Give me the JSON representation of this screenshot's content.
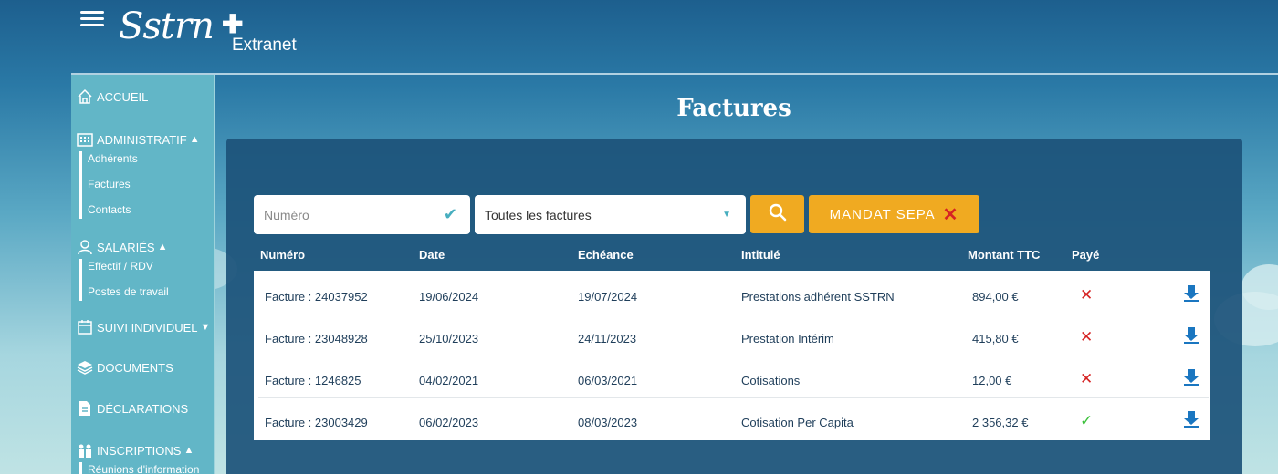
{
  "header": {
    "logo_script": "Sstrn",
    "logo_sub": "Extranet"
  },
  "sidebar": {
    "accueil": "ACCUEIL",
    "administratif": {
      "label": "ADMINISTRATIF",
      "items": [
        "Adhérents",
        "Factures",
        "Contacts"
      ]
    },
    "salaries": {
      "label": "SALARIÉS",
      "items": [
        "Effectif / RDV",
        "Postes de travail"
      ]
    },
    "suivi": "SUIVI INDIVIDUEL",
    "documents": "DOCUMENTS",
    "declarations": "DÉCLARATIONS",
    "inscriptions": {
      "label": "INSCRIPTIONS",
      "items": [
        "Réunions d'information"
      ]
    }
  },
  "main": {
    "title": "Factures",
    "search": {
      "numero_placeholder": "Numéro",
      "select_value": "Toutes les factures",
      "sepa_label": "MANDAT SEPA"
    },
    "columns": [
      "Numéro",
      "Date",
      "Echéance",
      "Intitulé",
      "Montant TTC",
      "Payé"
    ],
    "rows": [
      {
        "numero": "Facture : 24037952",
        "date": "19/06/2024",
        "echeance": "19/07/2024",
        "intitule": "Prestations adhérent SSTRN",
        "montant": "894,00 €",
        "paye": false
      },
      {
        "numero": "Facture : 23048928",
        "date": "25/10/2023",
        "echeance": "24/11/2023",
        "intitule": "Prestation Intérim",
        "montant": "415,80 €",
        "paye": false
      },
      {
        "numero": "Facture : 1246825",
        "date": "04/02/2021",
        "echeance": "06/03/2021",
        "intitule": "Cotisations",
        "montant": "12,00 €",
        "paye": false
      },
      {
        "numero": "Facture : 23003429",
        "date": "06/02/2023",
        "echeance": "08/03/2023",
        "intitule": "Cotisation Per Capita",
        "montant": "2 356,32 €",
        "paye": true
      }
    ]
  },
  "icons": {
    "paid": "check-icon",
    "unpaid": "cross-icon",
    "download": "download-icon"
  },
  "colors": {
    "accent": "#f0aa21",
    "unpaid": "#d62323",
    "paid": "#3cc13c",
    "download": "#1a76c0"
  }
}
